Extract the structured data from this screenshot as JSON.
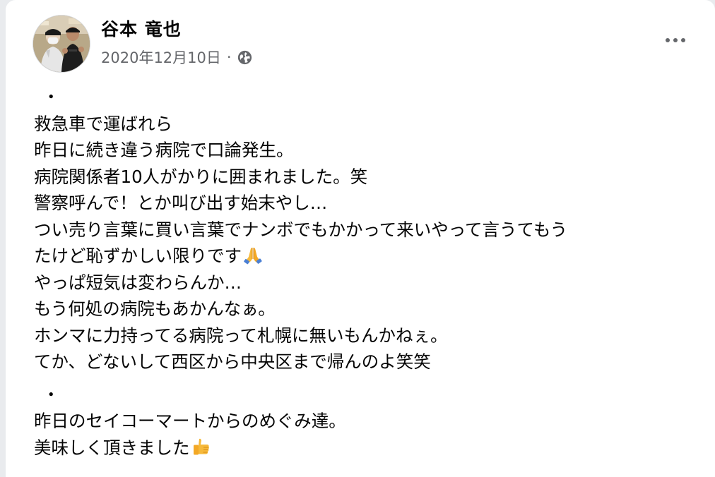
{
  "post": {
    "author": "谷本 竜也",
    "date": "2020年12月10日",
    "separator": "·",
    "privacy_icon": "globe-icon",
    "more_icon": "more-options-icon",
    "paragraph1": {
      "bullet": "・",
      "lines": [
        "救急車で運ばれら",
        "昨日に続き違う病院で口論発生。",
        "病院関係者10人がかりに囲まれました。笑",
        "警察呼んで！とか叫び出す始末やし…",
        "つい売り言葉に買い言葉でナンボでもかかって来いやって言うてもう",
        "たけど恥ずかしい限りです",
        "やっぱ短気は変わらんか…",
        "もう何処の病院もあかんなぁ。",
        "ホンマに力持ってる病院って札幌に無いもんかねぇ。",
        "てか、どないして西区から中央区まで帰んのよ笑笑"
      ],
      "emoji": "folded-hands-emoji"
    },
    "paragraph2": {
      "bullet": "・",
      "lines": [
        "昨日のセイコーマートからのめぐみ達。",
        "美味しく頂きました"
      ],
      "emoji": "thumbs-up-emoji"
    }
  },
  "colors": {
    "background": "#e9ebee",
    "card": "#ffffff",
    "text": "#050505",
    "secondary_text": "#65676b"
  }
}
